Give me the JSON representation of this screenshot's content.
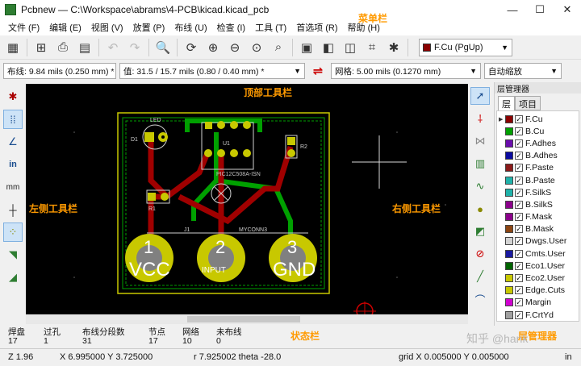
{
  "window": {
    "title": "Pcbnew — C:\\Workspace\\abrams\\4-PCB\\kicad.kicad_pcb",
    "minimize": "—",
    "maximize": "☐",
    "close": "✕"
  },
  "menu": [
    "文件 (F)",
    "编辑 (E)",
    "视图 (V)",
    "放置 (P)",
    "布线 (U)",
    "检查 (I)",
    "工具 (T)",
    "首选项 (R)",
    "帮助 (H)"
  ],
  "toolbar": {
    "active_layer": "F.Cu (PgUp)"
  },
  "toolbar2": {
    "track": "布线: 9.84 mils (0.250 mm) *",
    "via": "值: 31.5 / 15.7 mils (0.80 / 0.40 mm) *",
    "grid": "网格: 5.00 mils (0.1270 mm)",
    "zoom": "自动缩放"
  },
  "left_toolbar": {
    "units_label": "in",
    "mm_label": "mm"
  },
  "layer_manager": {
    "title": "层管理器",
    "tabs": [
      "层",
      "项目"
    ],
    "layers": [
      {
        "name": "F.Cu",
        "color": "#8b0000",
        "checked": true,
        "active": true
      },
      {
        "name": "B.Cu",
        "color": "#00a000",
        "checked": true
      },
      {
        "name": "F.Adhes",
        "color": "#6a0dad",
        "checked": true
      },
      {
        "name": "B.Adhes",
        "color": "#0a0aa0",
        "checked": true
      },
      {
        "name": "F.Paste",
        "color": "#8b1a1a",
        "checked": true
      },
      {
        "name": "B.Paste",
        "color": "#20b2aa",
        "checked": true
      },
      {
        "name": "F.SilkS",
        "color": "#20b2aa",
        "checked": true
      },
      {
        "name": "B.SilkS",
        "color": "#8b008b",
        "checked": true
      },
      {
        "name": "F.Mask",
        "color": "#8b008b",
        "checked": true
      },
      {
        "name": "B.Mask",
        "color": "#8b4513",
        "checked": true
      },
      {
        "name": "Dwgs.User",
        "color": "#d3d3d3",
        "checked": true
      },
      {
        "name": "Cmts.User",
        "color": "#1a1aa0",
        "checked": true
      },
      {
        "name": "Eco1.User",
        "color": "#006400",
        "checked": true
      },
      {
        "name": "Eco2.User",
        "color": "#c8c800",
        "checked": true
      },
      {
        "name": "Edge.Cuts",
        "color": "#c8c800",
        "checked": true
      },
      {
        "name": "Margin",
        "color": "#d000d0",
        "checked": true
      },
      {
        "name": "F.CrtYd",
        "color": "#a0a0a0",
        "checked": true
      }
    ]
  },
  "status": {
    "cols": [
      {
        "label": "焊盘",
        "value": "17"
      },
      {
        "label": "过孔",
        "value": "1"
      },
      {
        "label": "布线分段数",
        "value": "31"
      },
      {
        "label": "节点",
        "value": "17"
      },
      {
        "label": "网络",
        "value": "10"
      },
      {
        "label": "未布线",
        "value": "0"
      }
    ]
  },
  "bottom": {
    "zoom": "Z 1.96",
    "xy": "X 6.995000  Y 3.725000",
    "polar": "r 7.925002  theta -28.0",
    "grid": "grid X 0.005000  Y 0.005000",
    "units": "in"
  },
  "pcb": {
    "ref_led": "LED",
    "ref_d1": "D1",
    "ref_u1": "U1",
    "ref_r2": "R2",
    "ref_r1": "R1",
    "value_u1": "PIC12C508A-ISN",
    "conn_ref": "J1",
    "conn_value": "MYCONN3",
    "pad_nums": [
      "1",
      "2",
      "3"
    ],
    "pad_labels": [
      "VCC",
      "INPUT",
      "GND"
    ]
  },
  "annotations": {
    "menubar": "菜单栏",
    "top_toolbar": "顶部工具栏",
    "left_toolbar": "左侧工具栏",
    "right_toolbar": "右侧工具栏",
    "statusbar": "状态栏",
    "layer_manager": "层管理器"
  },
  "watermark": "知乎 @hank"
}
